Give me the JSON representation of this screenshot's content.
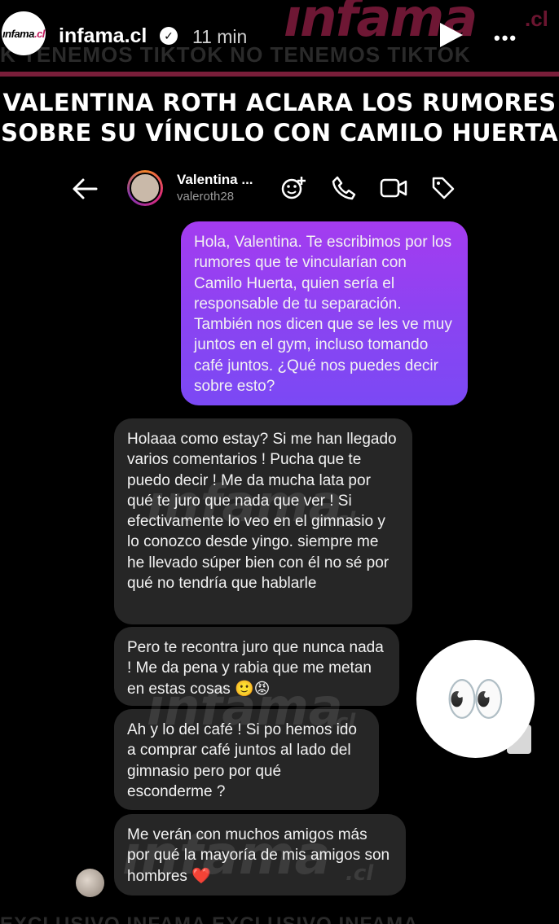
{
  "story": {
    "username": "infama.cl",
    "time": "11 min",
    "avatar_logo": "ınfama",
    "avatar_logo_suffix": ".cl",
    "bg_logo": "ınfama",
    "bg_logo_suffix": ".cl",
    "bg_strip": "K TENEMOS TIKTOK     NO TENEMOS TIKTOK",
    "footer_strip": "EXCLUSIVO INFAMA     EXCLUSIVO INFAMA"
  },
  "headline": {
    "line1": "VALENTINA ROTH ACLARA LOS RUMORES",
    "line2": "SOBRE SU VÍNCULO CON CAMILO HUERTA"
  },
  "dm": {
    "name": "Valentina ...",
    "handle": "valeroth28"
  },
  "messages": {
    "sent_1": "Hola, Valentina. Te escribimos por los rumores que te vincularían con Camilo Huerta, quien sería el responsable de tu separación. También nos dicen que se les ve muy juntos en el gym, incluso tomando café juntos. ¿Qué nos puedes decir sobre esto?",
    "recv_1": "Holaaa como estay?  Si me han llegado varios comentarios ! Pucha que te puedo decir ! Me da mucha lata por qué te juro que nada que ver ! Si efectivamente lo veo en el gimnasio y lo conozco desde yingo. siempre me he llevado súper bien con él  no sé por qué no tendría que hablarle",
    "recv_2": "Pero te recontra juro que nunca nada ! Me da pena y rabia que me metan en estas cosas 🙂😡",
    "recv_3": "Ah y lo del café ! Si po hemos ido a comprar café juntos al lado del gimnasio pero por qué esconderme ?",
    "recv_4": "Me verán con muchos amigos más por qué la mayoría de mis amigos son hombres ❤️"
  },
  "watermark": {
    "text": "ınfama",
    "suffix": ".cl"
  },
  "sticker": {
    "glyph": "👀"
  },
  "colors": {
    "accent": "#7a1e3a",
    "sent_bubble": "#9b3ff0",
    "received_bubble": "#262626"
  }
}
